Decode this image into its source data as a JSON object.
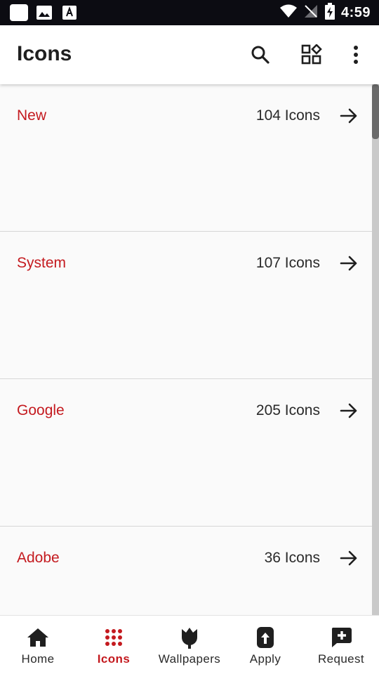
{
  "status_bar": {
    "time": "4:59"
  },
  "app_bar": {
    "title": "Icons"
  },
  "sections": [
    {
      "title": "New",
      "count": "104 Icons"
    },
    {
      "title": "System",
      "count": "107 Icons"
    },
    {
      "title": "Google",
      "count": "205 Icons"
    },
    {
      "title": "Adobe",
      "count": "36 Icons"
    }
  ],
  "bottom_nav": [
    {
      "label": "Home",
      "icon": "home-icon",
      "active": false
    },
    {
      "label": "Icons",
      "icon": "apps-grid-icon",
      "active": true
    },
    {
      "label": "Wallpapers",
      "icon": "tulip-icon",
      "active": false
    },
    {
      "label": "Apply",
      "icon": "apply-icon",
      "active": false
    },
    {
      "label": "Request",
      "icon": "request-icon",
      "active": false
    }
  ],
  "colors": {
    "accent": "#c41a1f",
    "status_bar": "#0c0c12",
    "background": "#fafafa"
  }
}
